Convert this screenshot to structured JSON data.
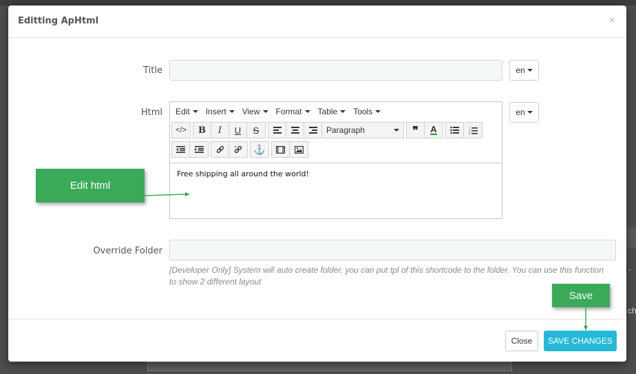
{
  "modal": {
    "title": "Editting ApHtml",
    "close_glyph": "×"
  },
  "form": {
    "title_label": "Title",
    "title_value": "",
    "html_label": "Html",
    "override_label": "Override Folder",
    "override_value": "",
    "lang": "en",
    "help_text": "[Developer Only] System will auto create folder, you can put tpl of this shortcode to the folder. You can use this function to show 2 different layout"
  },
  "editor": {
    "menus": [
      "Edit",
      "Insert",
      "View",
      "Format",
      "Table",
      "Tools"
    ],
    "format_select": "Paragraph",
    "content": "Free shipping all around the world!"
  },
  "footer": {
    "close_label": "Close",
    "save_label": "SAVE CHANGES"
  },
  "annotations": {
    "edit_html": "Edit html",
    "save": "Save",
    "color": "#3aaa59"
  },
  "background": {
    "ch": "ch",
    "dash": "-"
  },
  "colors": {
    "primary": "#25b9d7",
    "overlay": "#4d4d4d"
  }
}
